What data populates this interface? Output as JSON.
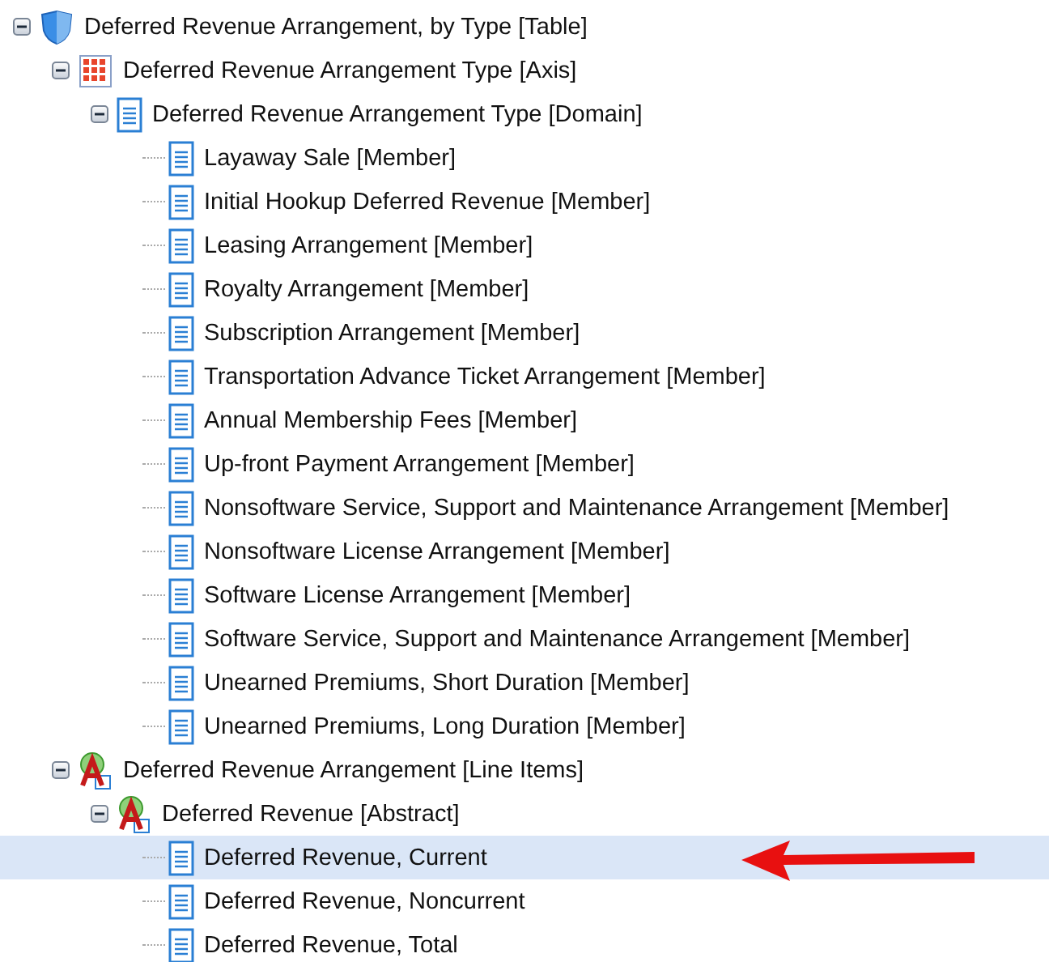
{
  "tree": [
    {
      "label": "Deferred Revenue Arrangement, by Type [Table]",
      "kind": "table",
      "expanded": true,
      "selected": false,
      "children": [
        {
          "label": "Deferred Revenue Arrangement Type [Axis]",
          "kind": "axis",
          "expanded": true,
          "selected": false,
          "children": [
            {
              "label": "Deferred Revenue Arrangement Type [Domain]",
              "kind": "member",
              "expanded": true,
              "selected": false,
              "children": [
                {
                  "label": "Layaway Sale [Member]",
                  "kind": "member",
                  "selected": false
                },
                {
                  "label": "Initial Hookup Deferred Revenue [Member]",
                  "kind": "member",
                  "selected": false
                },
                {
                  "label": "Leasing Arrangement [Member]",
                  "kind": "member",
                  "selected": false
                },
                {
                  "label": "Royalty Arrangement [Member]",
                  "kind": "member",
                  "selected": false
                },
                {
                  "label": "Subscription Arrangement [Member]",
                  "kind": "member",
                  "selected": false
                },
                {
                  "label": "Transportation Advance Ticket Arrangement [Member]",
                  "kind": "member",
                  "selected": false
                },
                {
                  "label": "Annual Membership Fees [Member]",
                  "kind": "member",
                  "selected": false
                },
                {
                  "label": "Up-front Payment Arrangement [Member]",
                  "kind": "member",
                  "selected": false
                },
                {
                  "label": "Nonsoftware Service, Support and Maintenance Arrangement [Member]",
                  "kind": "member",
                  "selected": false
                },
                {
                  "label": "Nonsoftware License Arrangement [Member]",
                  "kind": "member",
                  "selected": false
                },
                {
                  "label": "Software License Arrangement [Member]",
                  "kind": "member",
                  "selected": false
                },
                {
                  "label": "Software Service, Support and Maintenance Arrangement [Member]",
                  "kind": "member",
                  "selected": false
                },
                {
                  "label": "Unearned Premiums, Short Duration [Member]",
                  "kind": "member",
                  "selected": false
                },
                {
                  "label": "Unearned Premiums, Long Duration [Member]",
                  "kind": "member",
                  "selected": false
                }
              ]
            }
          ]
        },
        {
          "label": "Deferred Revenue Arrangement [Line Items]",
          "kind": "abstract",
          "expanded": true,
          "selected": false,
          "children": [
            {
              "label": "Deferred Revenue [Abstract]",
              "kind": "abstract",
              "expanded": true,
              "selected": false,
              "children": [
                {
                  "label": "Deferred Revenue, Current",
                  "kind": "member",
                  "selected": true
                },
                {
                  "label": "Deferred Revenue, Noncurrent",
                  "kind": "member",
                  "selected": false
                },
                {
                  "label": "Deferred Revenue, Total",
                  "kind": "member",
                  "selected": false
                }
              ]
            }
          ]
        }
      ]
    }
  ]
}
